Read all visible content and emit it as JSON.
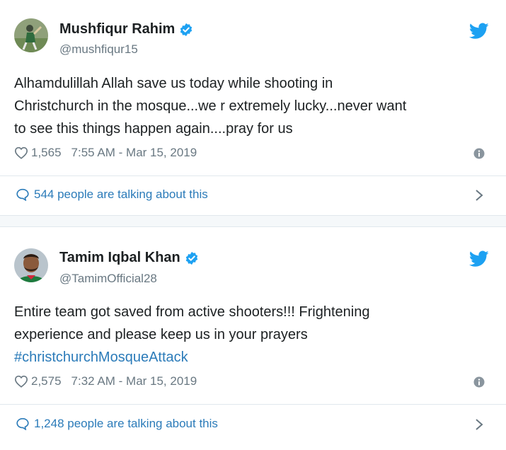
{
  "tweets": [
    {
      "name": "Mushfiqur Rahim",
      "handle": "@mushfiqur15",
      "text": "Alhamdulillah Allah save us today  while shooting in\nChristchurch in the mosque...we r extremely lucky...never want\nto see this things happen again....pray for us",
      "hashtag": "",
      "likes": "1,565",
      "timestamp": "7:55 AM - Mar 15, 2019",
      "talking": "544 people are talking about this"
    },
    {
      "name": "Tamim Iqbal Khan",
      "handle": "@TamimOfficial28",
      "text": "Entire team got saved from active shooters!!! Frightening\nexperience and please keep us in your prayers",
      "hashtag": "#christchurchMosqueAttack",
      "likes": "2,575",
      "timestamp": "7:32 AM - Mar 15, 2019",
      "talking": "1,248 people are talking about this"
    }
  ],
  "icons": {
    "verified": "verified-badge-icon",
    "bird": "twitter-bird-icon",
    "heart": "heart-icon",
    "info": "info-icon",
    "bubble": "speech-bubble-icon",
    "chevron": "chevron-right-icon"
  },
  "colors": {
    "link": "#2b7bb9",
    "twitter_blue": "#1da1f2",
    "muted": "#697882",
    "text": "#1c2022"
  }
}
